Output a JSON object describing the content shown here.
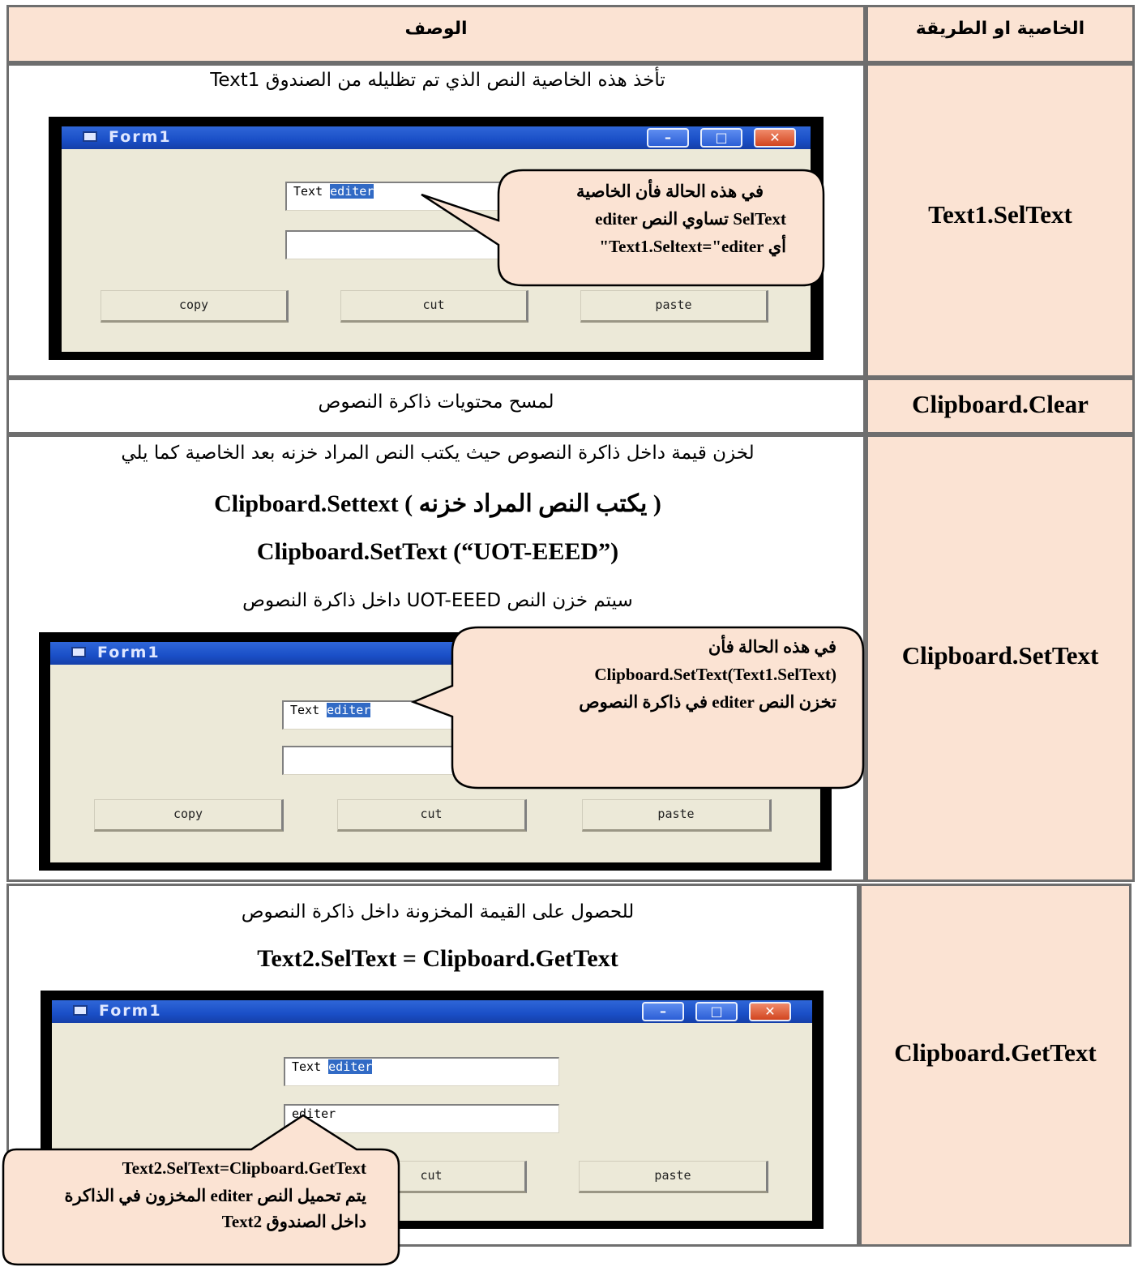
{
  "table": {
    "header": {
      "method_col": "الخاصية او الطريقة",
      "desc_col": "الوصف"
    },
    "rows": [
      {
        "method": "Text1.SelText",
        "desc": "تأخذ هذه الخاصية النص الذي تم تظليله من الصندوق Text1",
        "window": {
          "title": "Form1",
          "text1_prefix": "Text",
          "text1_selected": "editer",
          "text2": "",
          "buttons": [
            "copy",
            "cut",
            "paste"
          ]
        },
        "callout": {
          "line1": "في هذه الحالة فأن الخاصية",
          "line2": "SelText تساوي النص editer",
          "line3": "أي Text1.Seltext=\"editer\""
        }
      },
      {
        "method": "Clipboard.Clear",
        "desc": "لمسح محتويات ذاكرة النصوص"
      },
      {
        "method": "Clipboard.SetText",
        "desc": "لخزن قيمة داخل ذاكرة النصوص حيث يكتب النص المراد خزنه بعد الخاصية كما يلي",
        "syntax": "Clipboard.Settext  ( يكتب النص المراد خزنه )",
        "example": "Clipboard.SetText (“UOT-EEED”)",
        "result": "سيتم خزن النص  UOT-EEED داخل ذاكرة النصوص",
        "window": {
          "title": "Form1",
          "text1_prefix": "Text",
          "text1_selected": "editer",
          "text2": "",
          "buttons": [
            "copy",
            "cut",
            "paste"
          ]
        },
        "callout": {
          "line1": "في هذه الحالة فأن",
          "line2": "Clipboard.SetText(Text1.SelText)",
          "line3": "تخزن النص editer في ذاكرة النصوص"
        }
      },
      {
        "method": "Clipboard.GetText",
        "desc": "للحصول على القيمة المخزونة داخل ذاكرة النصوص",
        "example": "Text2.SelText = Clipboard.GetText",
        "window": {
          "title": "Form1",
          "text1_prefix": "Text",
          "text1_selected": "editer",
          "text2": "editer",
          "buttons": [
            "cut",
            "paste"
          ]
        },
        "callout": {
          "line1": "Text2.SelText=Clipboard.GetText",
          "line2": "يتم تحميل النص editer المخزون في الذاكرة",
          "line3": "داخل الصندوق Text2"
        }
      }
    ]
  },
  "colors": {
    "peach": "#fbe3d3",
    "border": "#6e6e6e",
    "callout_fill": "#fbe3d3",
    "selection": "#316ac5"
  }
}
